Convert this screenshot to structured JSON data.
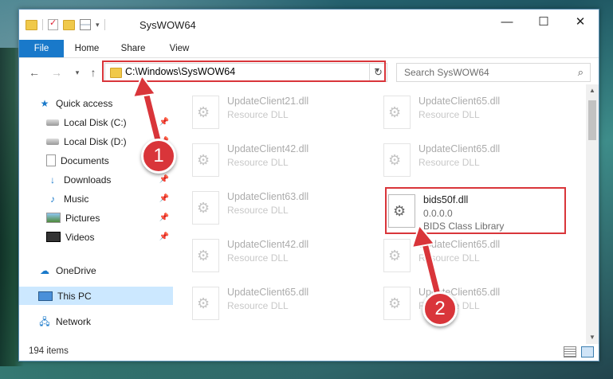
{
  "window": {
    "title": "SysWOW64",
    "controls": {
      "minimize": "—",
      "maximize": "☐",
      "close": "✕"
    }
  },
  "ribbon": {
    "tabs": [
      {
        "label": "File"
      },
      {
        "label": "Home"
      },
      {
        "label": "Share"
      },
      {
        "label": "View"
      }
    ]
  },
  "navbar": {
    "address": "C:\\Windows\\SysWOW64",
    "search_placeholder": "Search SysWOW64"
  },
  "sidebar": {
    "items": [
      {
        "label": "Quick access",
        "icon": "star-icon"
      },
      {
        "label": "Local Disk (C:)",
        "icon": "disk-icon",
        "pinned": true
      },
      {
        "label": "Local Disk (D:)",
        "icon": "disk-icon",
        "pinned": true
      },
      {
        "label": "Documents",
        "icon": "document-icon",
        "pinned": true
      },
      {
        "label": "Downloads",
        "icon": "download-icon",
        "pinned": true
      },
      {
        "label": "Music",
        "icon": "music-icon",
        "pinned": true
      },
      {
        "label": "Pictures",
        "icon": "pictures-icon",
        "pinned": true
      },
      {
        "label": "Videos",
        "icon": "videos-icon",
        "pinned": true
      },
      {
        "label": "OneDrive",
        "icon": "cloud-icon"
      },
      {
        "label": "This PC",
        "icon": "computer-icon",
        "selected": true
      },
      {
        "label": "Network",
        "icon": "network-icon"
      }
    ]
  },
  "files": [
    {
      "name": "UpdateClient21.dll",
      "desc": "Resource DLL"
    },
    {
      "name": "UpdateClient65.dll",
      "desc": "Resource DLL"
    },
    {
      "name": "UpdateClient42.dll",
      "desc": "Resource DLL"
    },
    {
      "name": "UpdateClient65.dll",
      "desc": "Resource DLL"
    },
    {
      "name": "UpdateClient63.dll",
      "desc": "Resource DLL"
    },
    {
      "name": "bids50f.dll",
      "version": "0.0.0.0",
      "desc": "BIDS Class Library"
    },
    {
      "name": "UpdateClient42.dll",
      "desc": "Resource DLL"
    },
    {
      "name": "UpdateClient65.dll",
      "desc": "Resource DLL"
    },
    {
      "name": "UpdateClient65.dll",
      "desc": "Resource DLL"
    },
    {
      "name": "UpdateClient65.dll",
      "desc": "Resource DLL"
    }
  ],
  "status": {
    "item_count": "194 items"
  },
  "callouts": {
    "one": "1",
    "two": "2"
  },
  "colors": {
    "accent": "#1979ca",
    "highlight": "#d9353a",
    "selected_bg": "#cce8ff"
  }
}
